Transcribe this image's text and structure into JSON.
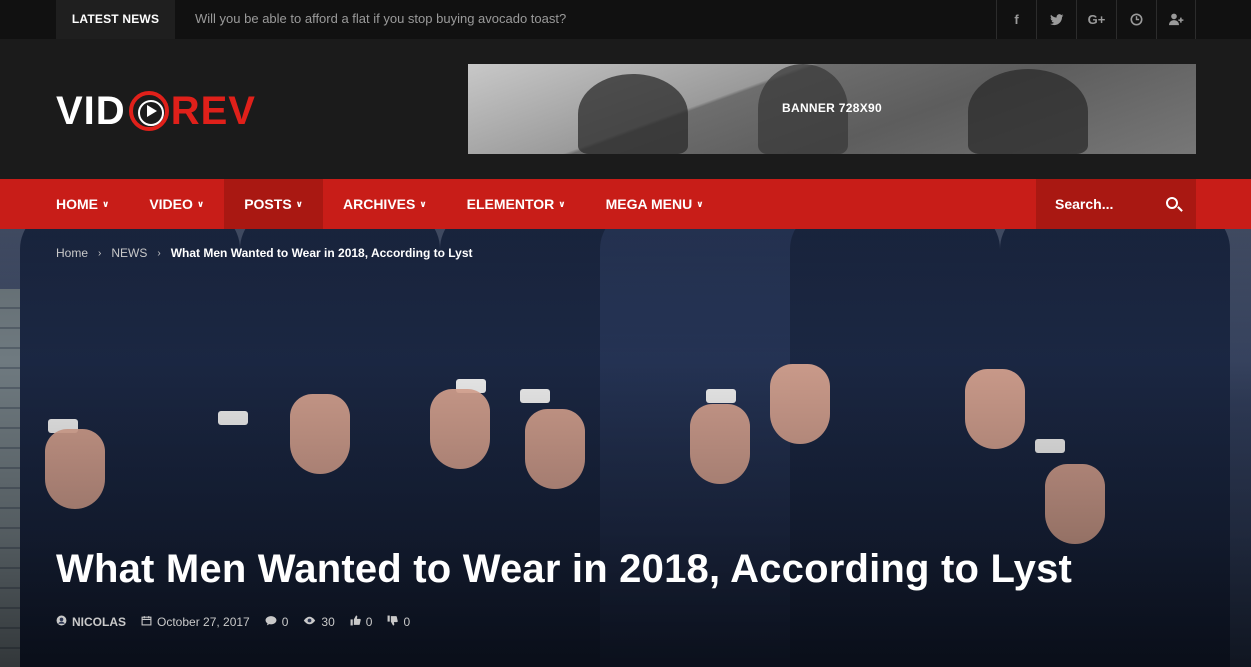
{
  "topbar": {
    "latest_label": "LATEST NEWS",
    "ticker_text": "Will you be able to afford a flat if you stop buying avocado toast?",
    "social": [
      {
        "icon": "facebook-icon",
        "glyph": "f"
      },
      {
        "icon": "twitter-icon",
        "glyph": "🐦"
      },
      {
        "icon": "google-plus-icon",
        "glyph": "G+"
      },
      {
        "icon": "clock-icon",
        "glyph": "◔"
      },
      {
        "icon": "user-plus-icon",
        "glyph": "👤"
      }
    ]
  },
  "header": {
    "logo_left": "VID",
    "logo_right": "REV",
    "banner_text": "BANNER 728X90"
  },
  "nav": {
    "items": [
      {
        "label": "HOME",
        "chevron": "∨"
      },
      {
        "label": "VIDEO",
        "chevron": "∨"
      },
      {
        "label": "POSTS",
        "chevron": "∨"
      },
      {
        "label": "ARCHIVES",
        "chevron": "∨"
      },
      {
        "label": "ELEMENTOR",
        "chevron": "∨"
      },
      {
        "label": "MEGA MENU",
        "chevron": "∨"
      }
    ],
    "active_index": 2,
    "search_placeholder": "Search..."
  },
  "breadcrumb": {
    "home": "Home",
    "category": "NEWS",
    "current": "What Men Wanted to Wear in 2018, According to Lyst",
    "separator": "›"
  },
  "post": {
    "title": "What Men Wanted to Wear in 2018, According to Lyst",
    "author": "NICOLAS",
    "date": "October 27, 2017",
    "comments": "0",
    "views": "30",
    "likes": "0",
    "dislikes": "0"
  },
  "colors": {
    "accent": "#c81d18",
    "accent_dark": "#a91812",
    "topbar_bg": "#111111",
    "header_bg": "#1b1b1b"
  }
}
